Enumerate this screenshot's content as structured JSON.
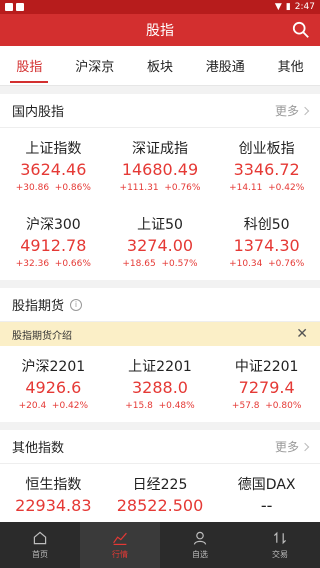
{
  "status": {
    "time": "2:47"
  },
  "appbar": {
    "title": "股指"
  },
  "tabs": [
    "股指",
    "沪深京",
    "板块",
    "港股通",
    "其他"
  ],
  "domestic": {
    "title": "国内股指",
    "more": "更多",
    "items": [
      {
        "name": "上证指数",
        "price": "3624.46",
        "change": "+30.86",
        "pct": "+0.86%"
      },
      {
        "name": "深证成指",
        "price": "14680.49",
        "change": "+111.31",
        "pct": "+0.76%"
      },
      {
        "name": "创业板指",
        "price": "3346.72",
        "change": "+14.11",
        "pct": "+0.42%"
      },
      {
        "name": "沪深300",
        "price": "4912.78",
        "change": "+32.36",
        "pct": "+0.66%"
      },
      {
        "name": "上证50",
        "price": "3274.00",
        "change": "+18.65",
        "pct": "+0.57%"
      },
      {
        "name": "科创50",
        "price": "1374.30",
        "change": "+10.34",
        "pct": "+0.76%"
      }
    ]
  },
  "futures": {
    "title": "股指期货",
    "banner": "股指期货介绍",
    "items": [
      {
        "name": "沪深2201",
        "price": "4926.6",
        "change": "+20.4",
        "pct": "+0.42%"
      },
      {
        "name": "上证2201",
        "price": "3288.0",
        "change": "+15.8",
        "pct": "+0.48%"
      },
      {
        "name": "中证2201",
        "price": "7279.4",
        "change": "+57.8",
        "pct": "+0.80%"
      }
    ]
  },
  "other": {
    "title": "其他指数",
    "more": "更多",
    "items": [
      {
        "name": "恒生指数",
        "price": "22934.83"
      },
      {
        "name": "日经225",
        "price": "28522.500"
      },
      {
        "name": "德国DAX",
        "price": "--"
      }
    ]
  },
  "nav": [
    "首页",
    "行情",
    "自选",
    "交易"
  ],
  "colors": {
    "brand": "#d32f2f",
    "up": "#e53935"
  }
}
